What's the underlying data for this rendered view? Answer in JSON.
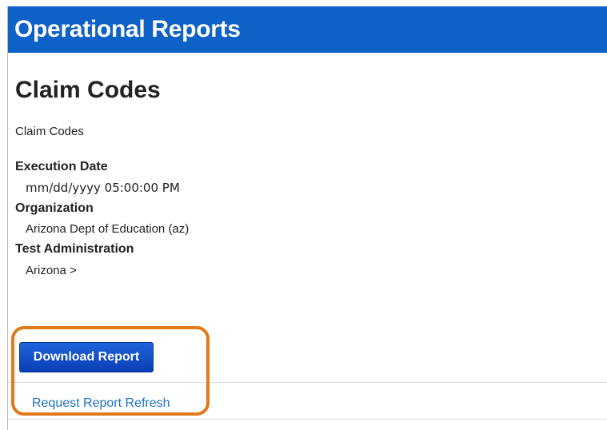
{
  "header": {
    "title": "Operational Reports"
  },
  "report": {
    "title": "Claim Codes",
    "subtitle": "Claim Codes",
    "fields": [
      {
        "label": "Execution Date",
        "value": "mm/dd/yyyy  05:00:00 PM"
      },
      {
        "label": "Organization",
        "value": "Arizona Dept of Education (az)"
      },
      {
        "label": "Test Administration",
        "value": "Arizona >"
      }
    ]
  },
  "actions": {
    "download_label": "Download Report",
    "refresh_label": "Request Report Refresh"
  },
  "colors": {
    "header_bg": "#0e61c6",
    "button_bg": "#1450cf",
    "link": "#1e73c8",
    "highlight": "#e07a1a"
  }
}
